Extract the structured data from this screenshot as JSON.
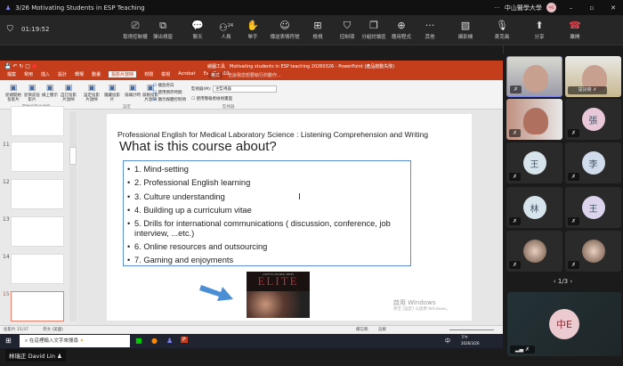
{
  "window": {
    "title": "3/26 Motivating Students in ESP Teaching",
    "org": "中山醫學大學",
    "user_initials": "中E",
    "more": "···"
  },
  "toolbar": {
    "timer": "01:19:52",
    "participants_count": "24",
    "buttons": [
      {
        "label": "取得控制權",
        "icon": "take-control"
      },
      {
        "label": "彈出視窗",
        "icon": "pop-out"
      },
      {
        "label": "聊天",
        "icon": "chat"
      },
      {
        "label": "人員",
        "icon": "people"
      },
      {
        "label": "舉手",
        "icon": "raise-hand"
      },
      {
        "label": "傳送表情符號",
        "icon": "emoji"
      },
      {
        "label": "檢視",
        "icon": "view"
      },
      {
        "label": "控制項",
        "icon": "shield"
      },
      {
        "label": "分組討論區",
        "icon": "breakout"
      },
      {
        "label": "應用程式",
        "icon": "apps"
      },
      {
        "label": "其他",
        "icon": "more"
      },
      {
        "label": "攝影機",
        "icon": "camera-off"
      },
      {
        "label": "麥克風",
        "icon": "mic-off"
      },
      {
        "label": "分享",
        "icon": "share"
      },
      {
        "label": "離開",
        "icon": "hang-up"
      }
    ]
  },
  "ppt": {
    "title": "Motivating students in ESP teaching 20260326 - PowerPoint (產品啟動失敗)",
    "drawing_tools": "繪圖工具",
    "format_tab": "格式",
    "search": "告訴我您想要執行的動作...",
    "tabs": [
      "檔案",
      "常用",
      "插入",
      "設計",
      "轉場",
      "動畫",
      "投影片放映",
      "校閱",
      "檢視",
      "Acrobat",
      "EverCam10"
    ],
    "active_tab": "投影片放映",
    "ribbon": {
      "groups": [
        "開始投影片放映",
        "設定",
        "監視器"
      ],
      "buttons": [
        "從頭開始投影片",
        "從目前投影片",
        "線上簡示",
        "自訂投影片放映",
        "設定投影片放映",
        "隱藏投影片",
        "排練計時",
        "錄製投影片放映"
      ],
      "checks": [
        "播放旁白",
        "使用預存時間",
        "顯示媒體控制項"
      ],
      "monitor_label": "監視器(M):",
      "monitor_value": "主監視器",
      "presenter_view": "使用簡報者檢視畫面"
    },
    "thumb_numbers": [
      "11",
      "12",
      "13",
      "14",
      "15"
    ],
    "status": {
      "slide": "投影片 15/37",
      "lang": "英文 (美國)",
      "notes": "備忘稿",
      "comments": "註解"
    },
    "watermark": {
      "line1": "啟用 Windows",
      "line2": "移至 [設定] 以啟用 Windows。"
    }
  },
  "slide": {
    "course": "Professional English for Medical Laboratory Science : Listening Comprehension and Writing",
    "title": "What is this course about?",
    "bullets": [
      "1. Mind-setting",
      "2. Professional English learning",
      "3. Culture understanding",
      "4. Building up a curriculum vitae",
      "5. Drills for international communications ( discussion, conference, job interview, ...etc.)",
      "6. Online resources and outsourcing",
      "7. Gaming and enjoyments"
    ],
    "poster_title": "ELITE",
    "poster_tag": "A NETFLIX ORIGINAL SERIES"
  },
  "taskbar": {
    "search": "在這裡輸入文字來搜尋",
    "ime": "中",
    "time": "下午",
    "date": "2026/3/26"
  },
  "presenter_label": "林瑞正 David Lin",
  "participants": [
    {
      "initial": "",
      "type": "video"
    },
    {
      "initial": "",
      "name": "楚詩薇",
      "type": "video"
    },
    {
      "initial": "",
      "type": "video"
    },
    {
      "initial": "張",
      "color": "#e8c8d8"
    },
    {
      "initial": "王",
      "color": "#d8e4ec"
    },
    {
      "initial": "李",
      "color": "#d0dcec"
    },
    {
      "initial": "林",
      "color": "#d8e4ec"
    },
    {
      "initial": "王",
      "color": "#dcd4ec"
    },
    {
      "initial": "",
      "type": "photo"
    },
    {
      "initial": "",
      "type": "photo"
    }
  ],
  "pager": "1/3",
  "accent": "#c43e1c"
}
